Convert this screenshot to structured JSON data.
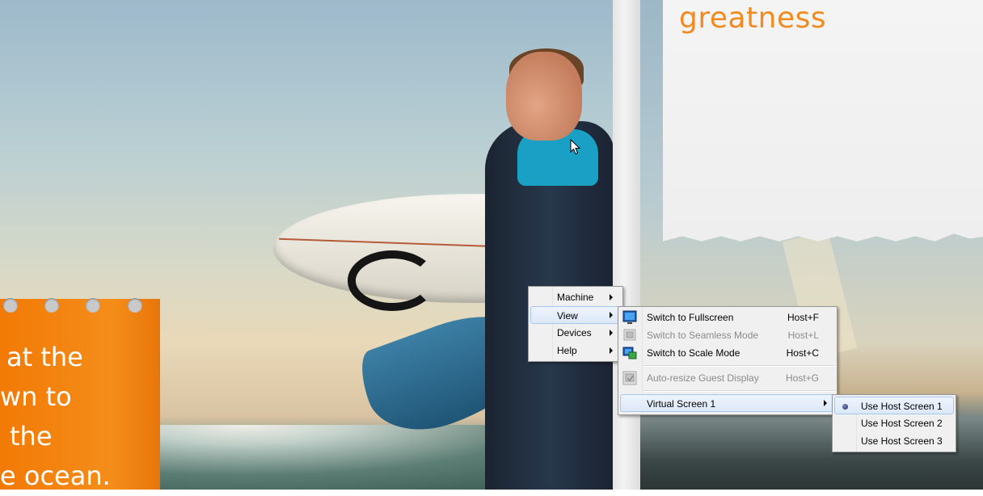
{
  "background": {
    "headline_word": "greatness",
    "orange_note_lines": [
      "at the",
      "wn to",
      "the",
      "e ocean."
    ],
    "accent_orange": "#f28a1e"
  },
  "main_menu": {
    "items": [
      {
        "label": "Machine",
        "has_submenu": true
      },
      {
        "label": "View",
        "has_submenu": true,
        "highlighted": true
      },
      {
        "label": "Devices",
        "has_submenu": true
      },
      {
        "label": "Help",
        "has_submenu": true
      }
    ]
  },
  "view_menu": {
    "items": [
      {
        "label": "Switch to Fullscreen",
        "shortcut": "Host+F",
        "icon": "fullscreen-icon",
        "enabled": true
      },
      {
        "label": "Switch to Seamless Mode",
        "shortcut": "Host+L",
        "icon": "seamless-icon",
        "enabled": false
      },
      {
        "label": "Switch to Scale Mode",
        "shortcut": "Host+C",
        "icon": "scale-mode-icon",
        "enabled": true
      },
      {
        "label": "Auto-resize Guest Display",
        "shortcut": "Host+G",
        "icon": "auto-resize-icon",
        "enabled": false
      },
      {
        "label": "Virtual Screen 1",
        "has_submenu": true,
        "highlighted": true
      }
    ]
  },
  "virtual_screen_menu": {
    "items": [
      {
        "label": "Use Host Screen 1",
        "selected": true
      },
      {
        "label": "Use Host Screen 2",
        "selected": false
      },
      {
        "label": "Use Host Screen 3",
        "selected": false
      }
    ]
  },
  "colors": {
    "menu_bg": "#f0f0f0",
    "menu_border": "#979797",
    "highlight_border": "#a9c6ec",
    "disabled_text": "#8b8b8b"
  }
}
